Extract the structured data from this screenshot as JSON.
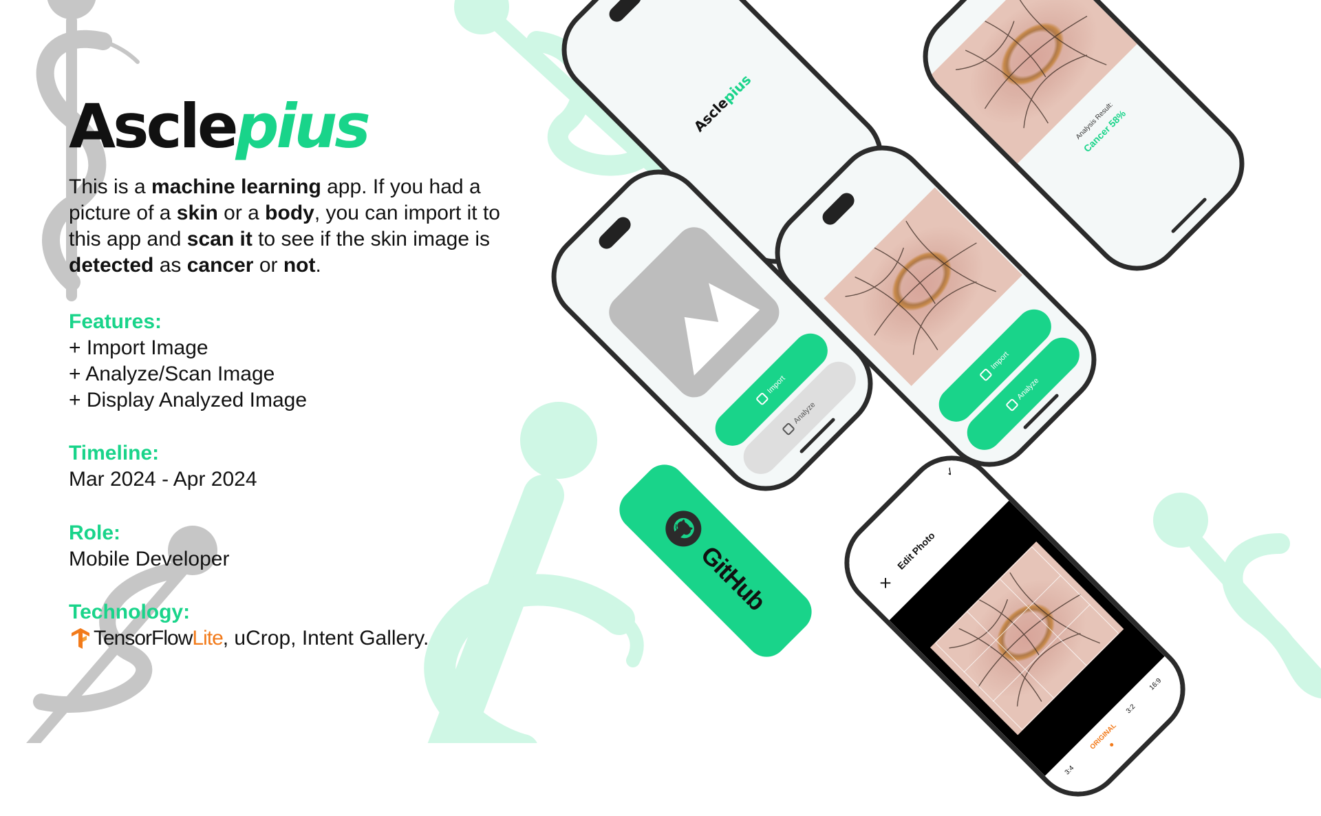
{
  "colors": {
    "accent": "#19d48a",
    "text": "#111111",
    "decor_gray": "#c6c6c6",
    "decor_mint": "#cff7e5",
    "tf_orange": "#f27a1a"
  },
  "logo": {
    "part1": "Ascle",
    "part2": "pius"
  },
  "intro": [
    {
      "text": "This is a ",
      "bold": false
    },
    {
      "text": "machine learning",
      "bold": true
    },
    {
      "text": " app. If you had a picture of a ",
      "bold": false
    },
    {
      "text": "skin",
      "bold": true
    },
    {
      "text": " or a ",
      "bold": false
    },
    {
      "text": "body",
      "bold": true
    },
    {
      "text": ", you can import it to this app and ",
      "bold": false
    },
    {
      "text": "scan it",
      "bold": true
    },
    {
      "text": " to see if the skin image is ",
      "bold": false
    },
    {
      "text": "detected",
      "bold": true
    },
    {
      "text": " as ",
      "bold": false
    },
    {
      "text": "cancer",
      "bold": true
    },
    {
      "text": " or ",
      "bold": false
    },
    {
      "text": "not",
      "bold": true
    },
    {
      "text": ".",
      "bold": false
    }
  ],
  "features": {
    "heading": "Features:",
    "items": [
      "+ Import Image",
      "+ Analyze/Scan Image",
      "+ Display Analyzed Image"
    ]
  },
  "timeline": {
    "heading": "Timeline:",
    "value": "Mar 2024 - Apr 2024"
  },
  "role": {
    "heading": "Role:",
    "value": "Mobile Developer"
  },
  "technology": {
    "heading": "Technology:",
    "icon": "tensorflow-icon",
    "tf_word": "TensorFlow",
    "tf_lite": "Lite",
    "rest": ", uCrop, Intent Gallery."
  },
  "phones": {
    "splash": {
      "logo_part1": "Ascle",
      "logo_part2": "pius"
    },
    "result": {
      "label": "Analysis Result:",
      "value": "Cancer 58%"
    },
    "buttons": {
      "import": "Import",
      "analyze": "Analyze"
    },
    "edit": {
      "title": "Edit Photo",
      "close": "✕",
      "check": "✓",
      "ratios": [
        "3:4",
        "ORIGINAL",
        "3:2",
        "16:9"
      ]
    }
  },
  "github": {
    "label": "GitHub",
    "icon": "github-icon"
  }
}
